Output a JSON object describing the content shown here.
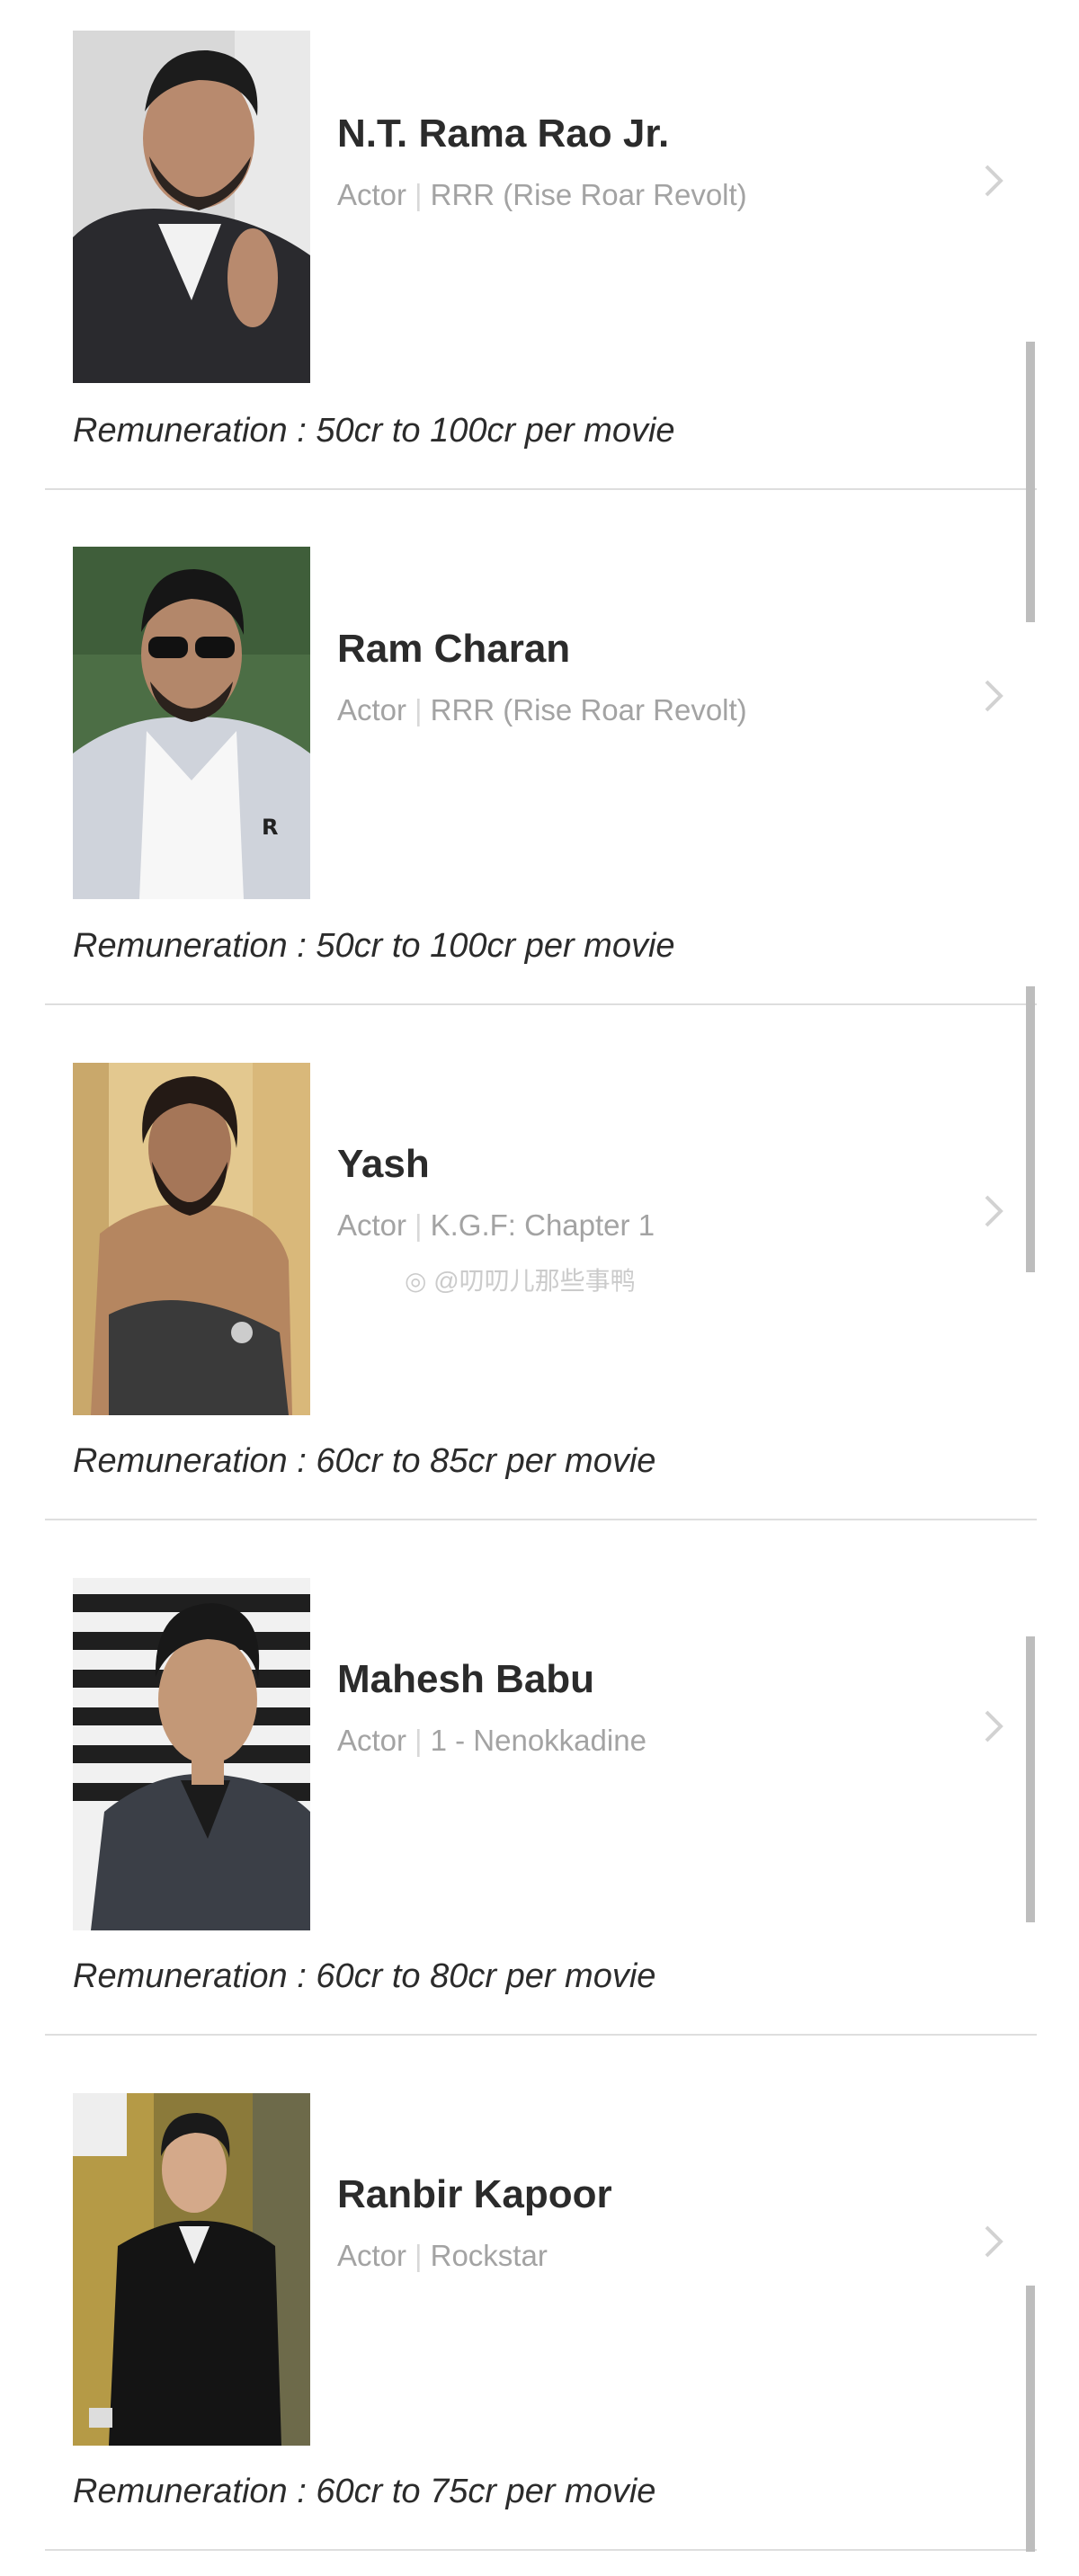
{
  "watermark": "@叨叨儿那些事鸭",
  "actors": [
    {
      "name": "N.T. Rama Rao Jr.",
      "role": "Actor",
      "film": "RRR (Rise Roar Revolt)",
      "remuneration": "Remuneration : 50cr to 100cr per movie"
    },
    {
      "name": "Ram Charan",
      "role": "Actor",
      "film": "RRR (Rise Roar Revolt)",
      "remuneration": "Remuneration : 50cr to 100cr per movie"
    },
    {
      "name": "Yash",
      "role": "Actor",
      "film": "K.G.F: Chapter 1",
      "remuneration": "Remuneration : 60cr to 85cr per movie"
    },
    {
      "name": "Mahesh Babu",
      "role": "Actor",
      "film": "1 - Nenokkadine",
      "remuneration": "Remuneration : 60cr to 80cr per movie"
    },
    {
      "name": "Ranbir Kapoor",
      "role": "Actor",
      "film": "Rockstar",
      "remuneration": "Remuneration : 60cr to 75cr per movie"
    }
  ],
  "icons": {
    "chevron": "chevron-right-icon",
    "watermark_logo": "weibo-icon"
  },
  "colors": {
    "name_text": "#2b2b2b",
    "meta_text": "#a3a3a3",
    "divider": "#dedede",
    "scrollbar": "#bdbdbd"
  }
}
